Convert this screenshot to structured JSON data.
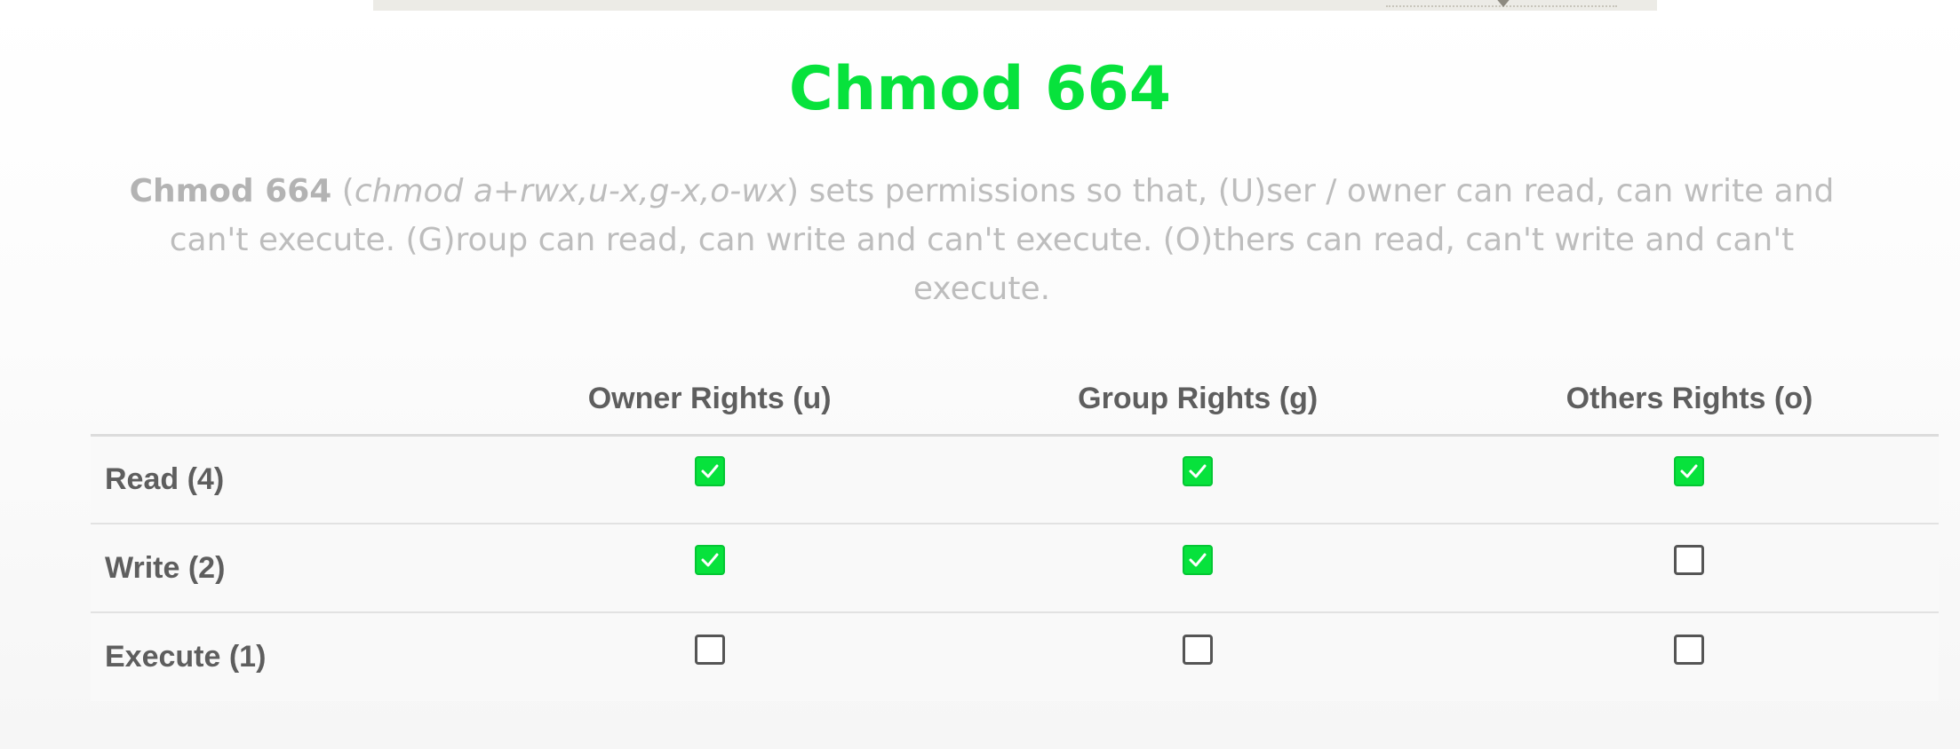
{
  "title": "Chmod 664",
  "description": {
    "bold": "Chmod 664",
    "open_paren": " (",
    "symbolic": "chmod a+rwx,u-x,g-x,o-wx",
    "rest": ") sets permissions so that, (U)ser / owner can read, can write and can't execute. (G)roup can read, can write and can't execute. (O)thers can read, can't write and can't execute."
  },
  "table": {
    "headers": [
      "",
      "Owner Rights (u)",
      "Group Rights (g)",
      "Others Rights (o)"
    ],
    "rows": [
      {
        "label": "Read (4)",
        "owner": true,
        "group": true,
        "others": true
      },
      {
        "label": "Write (2)",
        "owner": true,
        "group": true,
        "others": false
      },
      {
        "label": "Execute (1)",
        "owner": false,
        "group": false,
        "others": false
      }
    ]
  },
  "colors": {
    "accent": "#07e23c",
    "text": "#5e5e5e",
    "muted": "#bdbdbd"
  },
  "icons": {
    "checked": "checkbox-checked-icon",
    "unchecked": "checkbox-unchecked-icon"
  }
}
